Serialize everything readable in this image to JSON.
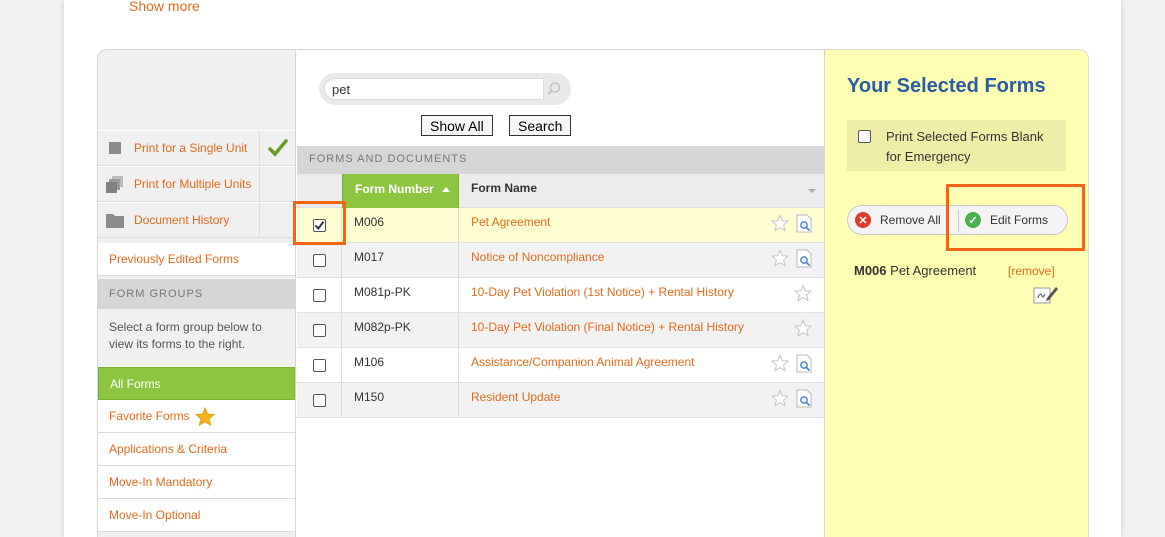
{
  "show_more": "Show more",
  "print_options": [
    {
      "label": "Print for a Single Unit"
    },
    {
      "label": "Print for Multiple Units"
    },
    {
      "label": "Document History"
    }
  ],
  "previously_edited": "Previously Edited Forms",
  "form_groups": {
    "heading": "FORM GROUPS",
    "description": "Select a form group below to view its forms to the right.",
    "items": [
      "All Forms",
      "Favorite Forms",
      "Applications & Criteria",
      "Move-In Mandatory",
      "Move-In Optional"
    ]
  },
  "search": {
    "value": "pet",
    "show_all_label": "Show All",
    "search_label": "Search"
  },
  "forms_section": {
    "heading": "FORMS AND DOCUMENTS",
    "col_number": "Form Number",
    "col_name": "Form Name",
    "rows": [
      {
        "number": "M006",
        "name": "Pet Agreement",
        "checked": true,
        "has_doc": true
      },
      {
        "number": "M017",
        "name": "Notice of Noncompliance",
        "checked": false,
        "has_doc": true
      },
      {
        "number": "M081p-PK",
        "name": "10-Day Pet Violation (1st Notice) + Rental History",
        "checked": false,
        "has_doc": false
      },
      {
        "number": "M082p-PK",
        "name": "10-Day Pet Violation (Final Notice) + Rental History",
        "checked": false,
        "has_doc": false
      },
      {
        "number": "M106",
        "name": "Assistance/Companion Animal Agreement",
        "checked": false,
        "has_doc": true
      },
      {
        "number": "M150",
        "name": "Resident Update",
        "checked": false,
        "has_doc": true
      }
    ]
  },
  "selected": {
    "title": "Your Selected Forms",
    "blank_line1": "Print Selected Forms Blank",
    "blank_line2": "for Emergency",
    "remove_all": "Remove All",
    "edit_forms": "Edit Forms",
    "item_number": "M006",
    "item_name": "Pet Agreement",
    "remove_link": "[remove]"
  },
  "colors": {
    "accent": "#e36a1e",
    "green": "#8dc540",
    "highlight": "#f56314",
    "title_blue": "#2a5ca8"
  }
}
